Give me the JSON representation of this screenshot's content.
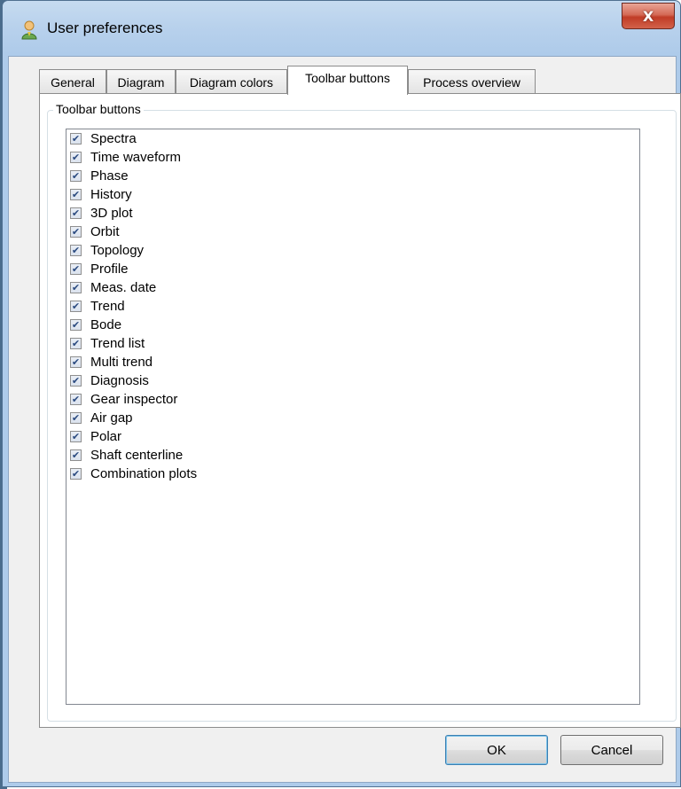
{
  "window": {
    "title": "User preferences",
    "close_label": "X"
  },
  "tabs": [
    {
      "label": "General"
    },
    {
      "label": "Diagram"
    },
    {
      "label": "Diagram colors"
    },
    {
      "label": "Toolbar buttons"
    },
    {
      "label": "Process overview"
    }
  ],
  "active_tab": "Toolbar buttons",
  "groupbox": {
    "title": "Toolbar buttons"
  },
  "items": [
    {
      "label": "Spectra",
      "checked": true
    },
    {
      "label": "Time waveform",
      "checked": true
    },
    {
      "label": "Phase",
      "checked": true
    },
    {
      "label": "History",
      "checked": true
    },
    {
      "label": "3D plot",
      "checked": true
    },
    {
      "label": "Orbit",
      "checked": true
    },
    {
      "label": "Topology",
      "checked": true
    },
    {
      "label": "Profile",
      "checked": true
    },
    {
      "label": "Meas. date",
      "checked": true
    },
    {
      "label": "Trend",
      "checked": true
    },
    {
      "label": "Bode",
      "checked": true
    },
    {
      "label": "Trend list",
      "checked": true
    },
    {
      "label": "Multi trend",
      "checked": true
    },
    {
      "label": "Diagnosis",
      "checked": true
    },
    {
      "label": "Gear inspector",
      "checked": true
    },
    {
      "label": "Air gap",
      "checked": true
    },
    {
      "label": "Polar",
      "checked": true
    },
    {
      "label": "Shaft centerline",
      "checked": true
    },
    {
      "label": "Combination plots",
      "checked": true
    }
  ],
  "buttons": {
    "ok": "OK",
    "cancel": "Cancel"
  },
  "icons": {
    "app": "user-icon",
    "check": "checkmark-icon",
    "close": "close-icon"
  },
  "colors": {
    "title_bar": "#b8d1ec",
    "close_button": "#c03c26",
    "client": "#f0f0f0"
  }
}
